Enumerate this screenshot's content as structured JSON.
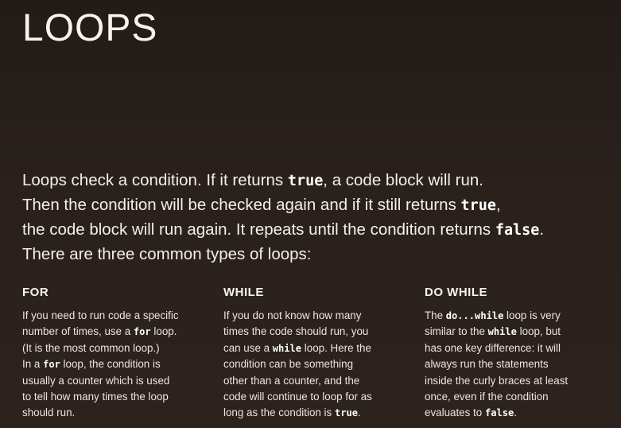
{
  "title": "LOOPS",
  "intro": [
    [
      "Loops check a condition. If it returns ",
      {
        "code": "true"
      },
      ", a code block will run."
    ],
    [
      "Then the condition will be checked again and if it still returns ",
      {
        "code": "true"
      },
      ","
    ],
    [
      "the code block will run again. It repeats until the condition returns ",
      {
        "code": "false"
      },
      "."
    ],
    [
      "There are three common types of loops:"
    ]
  ],
  "columns": [
    {
      "heading": "FOR",
      "lines": [
        [
          "If you need to run code a specific"
        ],
        [
          "number of times, use a ",
          {
            "code": "for"
          },
          " loop."
        ],
        [
          "(It is the most common loop.)"
        ],
        [
          "In a ",
          {
            "code": "for"
          },
          " loop, the condition is"
        ],
        [
          "usually a counter which is used"
        ],
        [
          "to tell how many times the loop"
        ],
        [
          "should run."
        ]
      ]
    },
    {
      "heading": "WHILE",
      "lines": [
        [
          "If you do not know how many"
        ],
        [
          "times the code should run, you"
        ],
        [
          "can use a ",
          {
            "code": "while"
          },
          " loop. Here the"
        ],
        [
          "condition can be something"
        ],
        [
          "other than a counter, and the"
        ],
        [
          "code will continue to loop for as"
        ],
        [
          "long as the condition is ",
          {
            "code": "true"
          },
          "."
        ]
      ]
    },
    {
      "heading": "DO WHILE",
      "lines": [
        [
          "The ",
          {
            "code": "do...while"
          },
          " loop is very"
        ],
        [
          "similar to the ",
          {
            "code": "while"
          },
          " loop, but"
        ],
        [
          "has one key difference: it will"
        ],
        [
          "always run the statements"
        ],
        [
          "inside the curly braces at least"
        ],
        [
          "once, even if the condition"
        ],
        [
          "evaluates to ",
          {
            "code": "false"
          },
          "."
        ]
      ]
    }
  ]
}
